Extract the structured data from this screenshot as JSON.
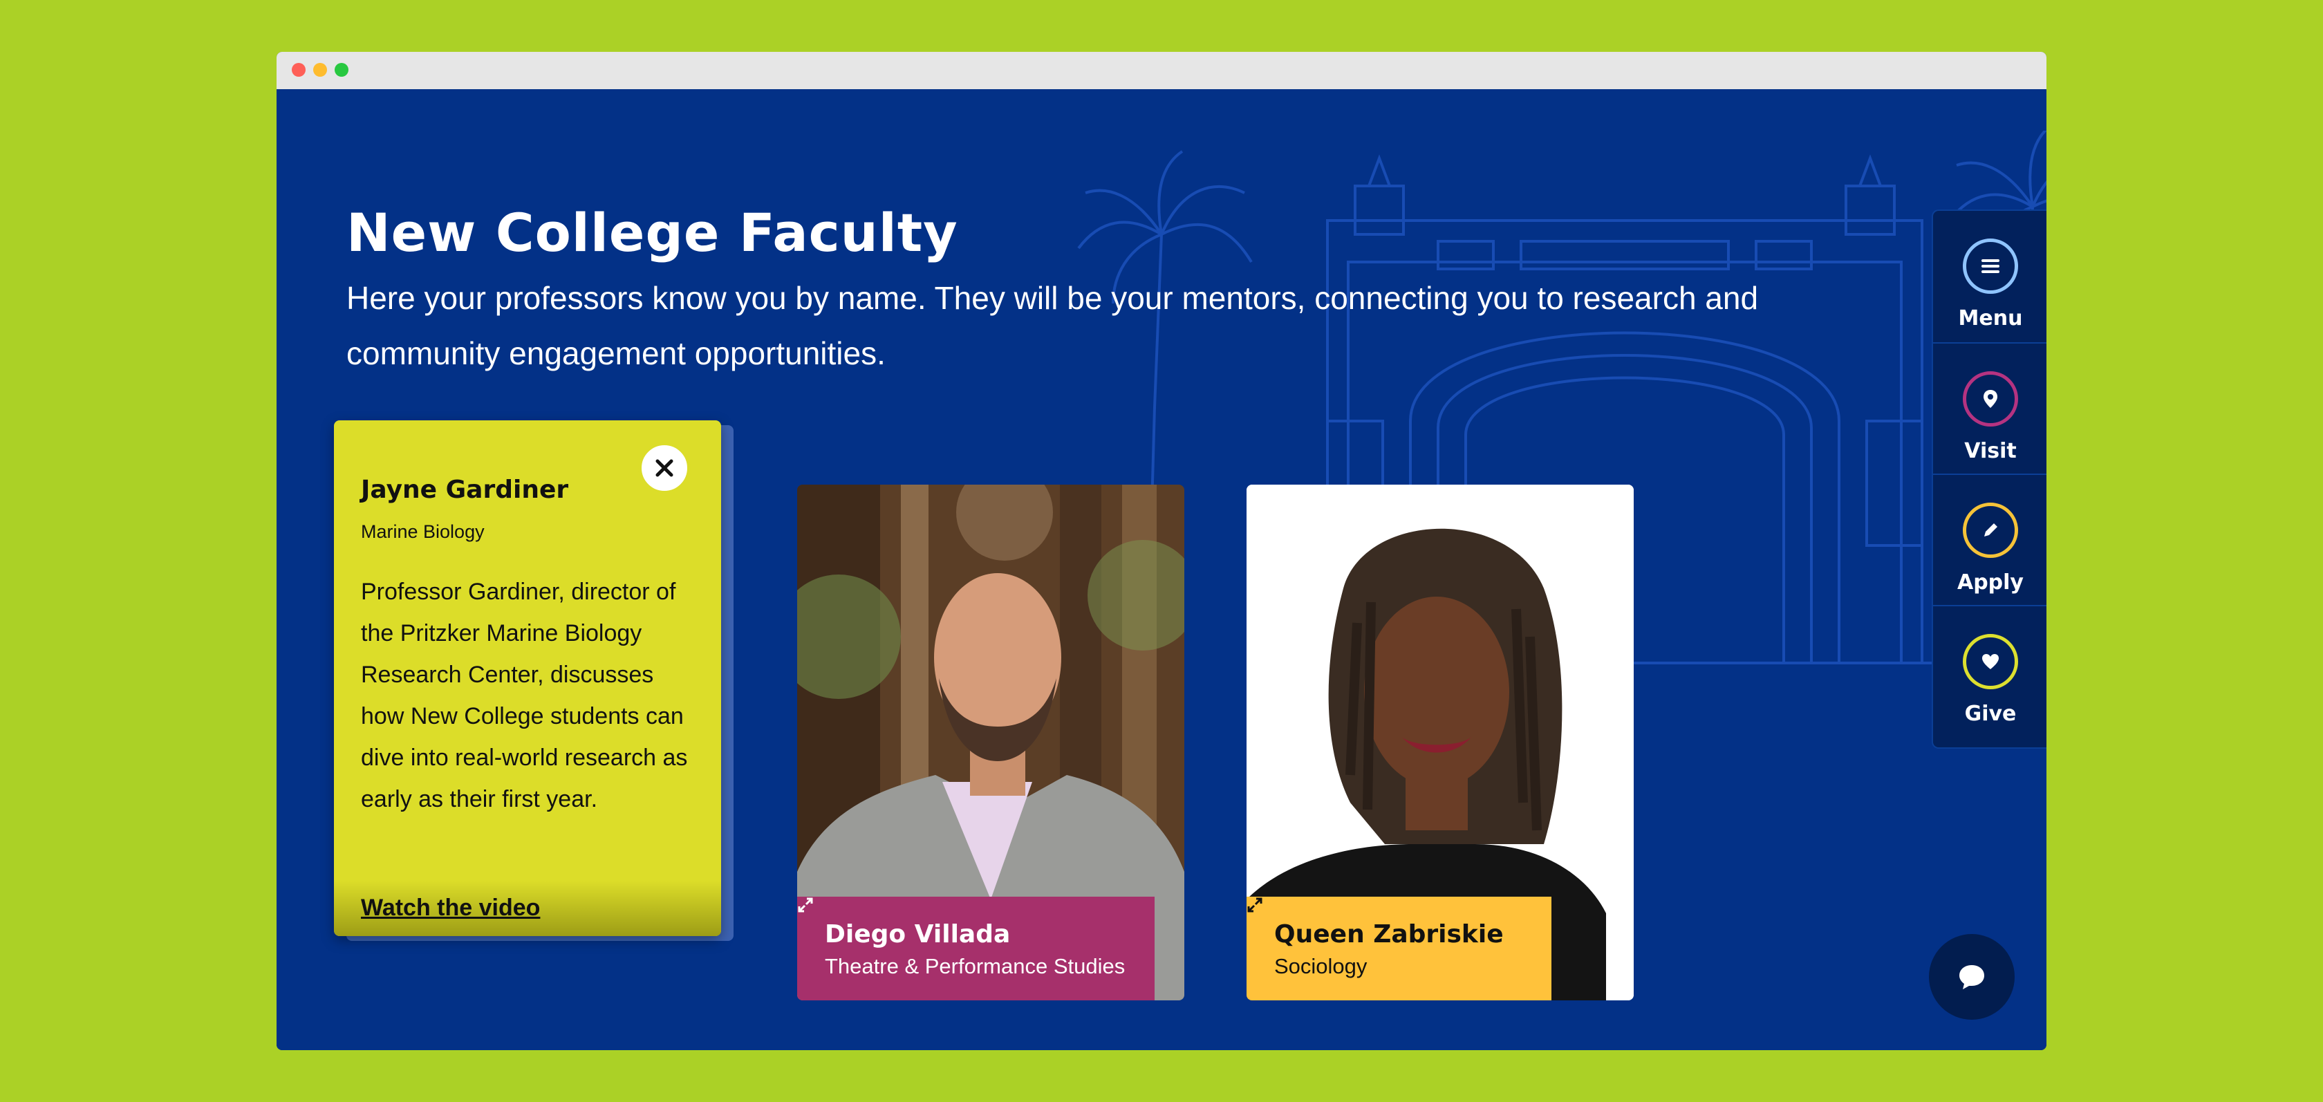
{
  "page": {
    "title": "New College Faculty",
    "subtitle": "Here your professors know you by name. They will be your mentors, connecting you to research and community engagement opportunities."
  },
  "faculty": [
    {
      "name": "Jayne Gardiner",
      "department": "Marine Biology",
      "bio": "Professor Gardiner, director of the Pritzker Marine Biology Research Center, discusses how New College students can dive into real-world research as early as their first year.",
      "link_label": "Watch the video",
      "close_icon": "close-icon",
      "card_color": "#dcdd29"
    },
    {
      "name": "Diego Villada",
      "department": "Theatre & Performance Studies",
      "expand_icon": "expand-icon",
      "label_color": "#a6306b"
    },
    {
      "name": "Queen Zabriskie",
      "department": "Sociology",
      "expand_icon": "expand-icon",
      "label_color": "#ffc23b"
    }
  ],
  "side_nav": {
    "items": [
      {
        "label": "Menu",
        "icon": "menu-icon",
        "ring_color": "#8fc4ff"
      },
      {
        "label": "Visit",
        "icon": "map-pin-icon",
        "ring_color": "#b53381"
      },
      {
        "label": "Apply",
        "icon": "pencil-icon",
        "ring_color": "#f6c338"
      },
      {
        "label": "Give",
        "icon": "heart-icon",
        "ring_color": "#dde02f"
      }
    ]
  },
  "chat": {
    "icon": "chat-bubble-icon"
  },
  "colors": {
    "page_background": "#abd126",
    "section_background": "#033187",
    "titlebar": "#e6e6e6"
  }
}
